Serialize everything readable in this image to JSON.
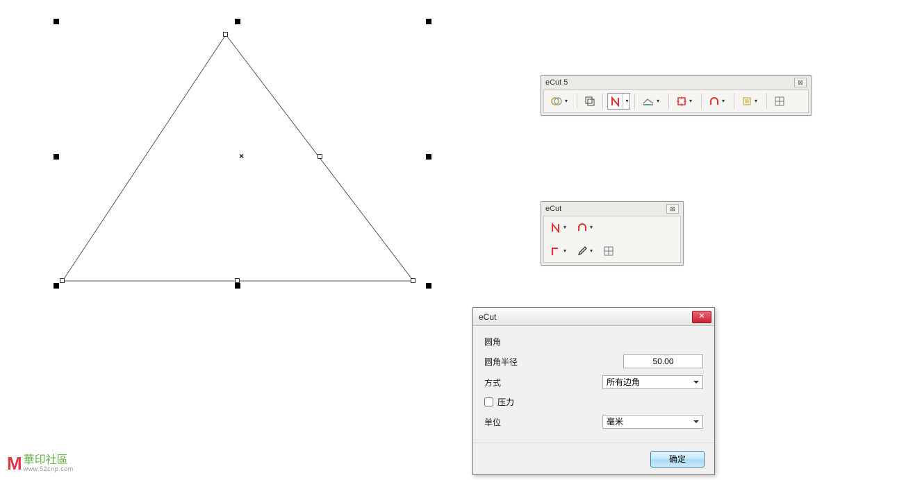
{
  "panel1": {
    "title": "eCut 5",
    "tools": [
      {
        "name": "venn-icon",
        "active": false,
        "dropdown": true
      },
      {
        "name": "copy-icon",
        "active": false,
        "dropdown": false
      },
      {
        "name": "nest-n-icon",
        "active": true,
        "dropdown": true,
        "split": true
      },
      {
        "name": "measure-icon",
        "active": false,
        "dropdown": true
      },
      {
        "name": "center-square-icon",
        "active": false,
        "dropdown": true
      },
      {
        "name": "arch-icon",
        "active": false,
        "dropdown": true
      },
      {
        "name": "reg-icon",
        "active": false,
        "dropdown": true
      },
      {
        "name": "grid-icon",
        "active": false,
        "dropdown": false
      }
    ]
  },
  "panel2": {
    "title": "eCut",
    "rows": [
      [
        {
          "name": "nest-n-icon",
          "dropdown": true
        },
        {
          "name": "arch-icon",
          "dropdown": true
        }
      ],
      [
        {
          "name": "corner-icon",
          "dropdown": true
        },
        {
          "name": "eyedropper-icon",
          "dropdown": true
        },
        {
          "name": "grid-icon",
          "dropdown": false
        }
      ]
    ]
  },
  "dialog": {
    "title": "eCut",
    "group": "圆角",
    "radius_label": "圆角半径",
    "radius_value": "50.00",
    "method_label": "方式",
    "method_value": "所有边角",
    "pressure_label": "压力",
    "pressure_checked": false,
    "unit_label": "单位",
    "unit_value": "毫米",
    "ok_label": "确定"
  },
  "watermark": {
    "chinese": "華印社區",
    "url": "www.52cnp.com"
  }
}
